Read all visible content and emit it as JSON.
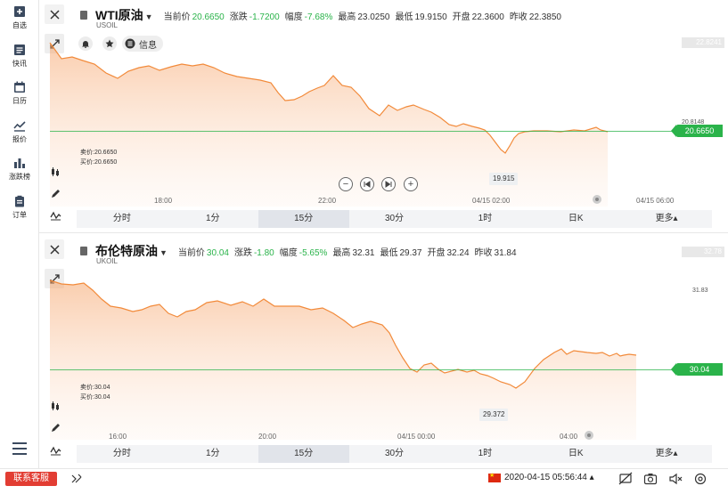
{
  "nav": {
    "items": [
      {
        "label": "自选",
        "icon": "bookmark-plus-icon"
      },
      {
        "label": "快讯",
        "icon": "news-icon"
      },
      {
        "label": "日历",
        "icon": "calendar-icon"
      },
      {
        "label": "报价",
        "icon": "quote-chart-icon"
      },
      {
        "label": "涨跌榜",
        "icon": "bar-chart-icon"
      },
      {
        "label": "订单",
        "icon": "clipboard-icon"
      }
    ],
    "menu_icon": "hamburger-icon"
  },
  "panels": [
    {
      "name": "WTI原油",
      "symbol": "USOIL",
      "quote": {
        "current_label": "当前价",
        "current": "20.6650",
        "change_label": "涨跌",
        "change": "-1.7200",
        "pct_label": "幅度",
        "pct": "-7.68%",
        "high_label": "最高",
        "high": "23.0250",
        "low_label": "最低",
        "low": "19.9150",
        "open_label": "开盘",
        "open": "22.3600",
        "prev_label": "昨收",
        "prev": "22.3850"
      },
      "info_label": "信息",
      "sell": "卖价:20.6650",
      "buy": "买价:20.6650",
      "price_badge": "20.6650",
      "top_badge": "22.8241",
      "axis_right": "20.8148",
      "min_label": "19.915",
      "times": [
        "18:00",
        "22:00",
        "04/15 02:00",
        "04/15 06:00"
      ],
      "timeframes": [
        "分时",
        "1分",
        "15分",
        "30分",
        "1时",
        "日K",
        "更多▴"
      ],
      "active_tf": "15分"
    },
    {
      "name": "布伦特原油",
      "symbol": "UKOIL",
      "quote": {
        "current_label": "当前价",
        "current": "30.04",
        "change_label": "涨跌",
        "change": "-1.80",
        "pct_label": "幅度",
        "pct": "-5.65%",
        "high_label": "最高",
        "high": "32.31",
        "low_label": "最低",
        "low": "29.37",
        "open_label": "开盘",
        "open": "32.24",
        "prev_label": "昨收",
        "prev": "31.84"
      },
      "sell": "卖价:30.04",
      "buy": "买价:30.04",
      "price_badge": "30.04",
      "top_badge": "32.78",
      "axis_right": "31.83",
      "min_label": "29.372",
      "times": [
        "16:00",
        "20:00",
        "04/15 00:00",
        "04:00"
      ],
      "timeframes": [
        "分时",
        "1分",
        "15分",
        "30分",
        "1时",
        "日K",
        "更多▴"
      ],
      "active_tf": "15分"
    }
  ],
  "statusbar": {
    "service_label": "联系客服",
    "datetime": "2020-04-15 05:56:44 ▴"
  },
  "colors": {
    "line": "#f28a3a",
    "green": "#2ab34a",
    "red": "#e23d33"
  }
}
